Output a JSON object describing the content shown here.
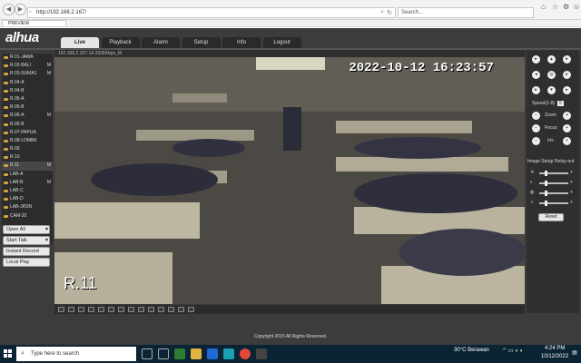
{
  "browser": {
    "url": "http://192.168.2.167/",
    "search_placeholder": "Search...",
    "tab_title": "PREVIEW"
  },
  "app": {
    "logo": "alhua",
    "tabs": [
      "Live",
      "Playback",
      "Alarm",
      "Setup",
      "Info",
      "Logout"
    ],
    "active_tab": "Live",
    "copyright": "Copyright 2015 All Rights Reserved."
  },
  "channels": [
    {
      "name": "R.01-JAWA",
      "m": ""
    },
    {
      "name": "R.02-BALI",
      "m": "M"
    },
    {
      "name": "R.03-SUMA1",
      "m": "M"
    },
    {
      "name": "R.04-A",
      "m": ""
    },
    {
      "name": "R.04-B",
      "m": ""
    },
    {
      "name": "R.05-A",
      "m": ""
    },
    {
      "name": "R.05-B",
      "m": ""
    },
    {
      "name": "R.06-A",
      "m": "M"
    },
    {
      "name": "R.06-B",
      "m": ""
    },
    {
      "name": "R.07-PAPUA",
      "m": ""
    },
    {
      "name": "R.08-LOMBK",
      "m": ""
    },
    {
      "name": "R.09",
      "m": ""
    },
    {
      "name": "R.10",
      "m": ""
    },
    {
      "name": "R.11",
      "m": "M"
    },
    {
      "name": "LAB-A",
      "m": ""
    },
    {
      "name": "LAB-B",
      "m": "M"
    },
    {
      "name": "LAB-C",
      "m": ""
    },
    {
      "name": "LAB-D",
      "m": ""
    },
    {
      "name": "LAB-JRSN",
      "m": ""
    },
    {
      "name": "CAM-20",
      "m": ""
    }
  ],
  "left_buttons": {
    "open_all": "Open All",
    "start_talk": "Start Talk",
    "instant_record": "Instant Record",
    "local_play": "Local Play"
  },
  "video": {
    "stream_info": "192.168.2.167-14 2926Kbps_M",
    "timestamp": "2022-10-12  16:23:57",
    "camera_name": "R.11"
  },
  "ptz": {
    "speed_label": "Speed(1-8)",
    "speed_value": "5",
    "zoom": "Zoom",
    "focus": "Focus",
    "iris": "Iris",
    "image_setup": "Image Setup",
    "relay_out": "Relay-out",
    "reset": "Reset"
  },
  "taskbar": {
    "search_placeholder": "Type here to search",
    "weather": "30°C  Berawan",
    "time": "4:24 PM",
    "date": "10/12/2022"
  },
  "colors": {
    "app_bg": "#3c3c3c",
    "channel_icon": "#d7a23a",
    "taskbar": "#0b2434"
  }
}
